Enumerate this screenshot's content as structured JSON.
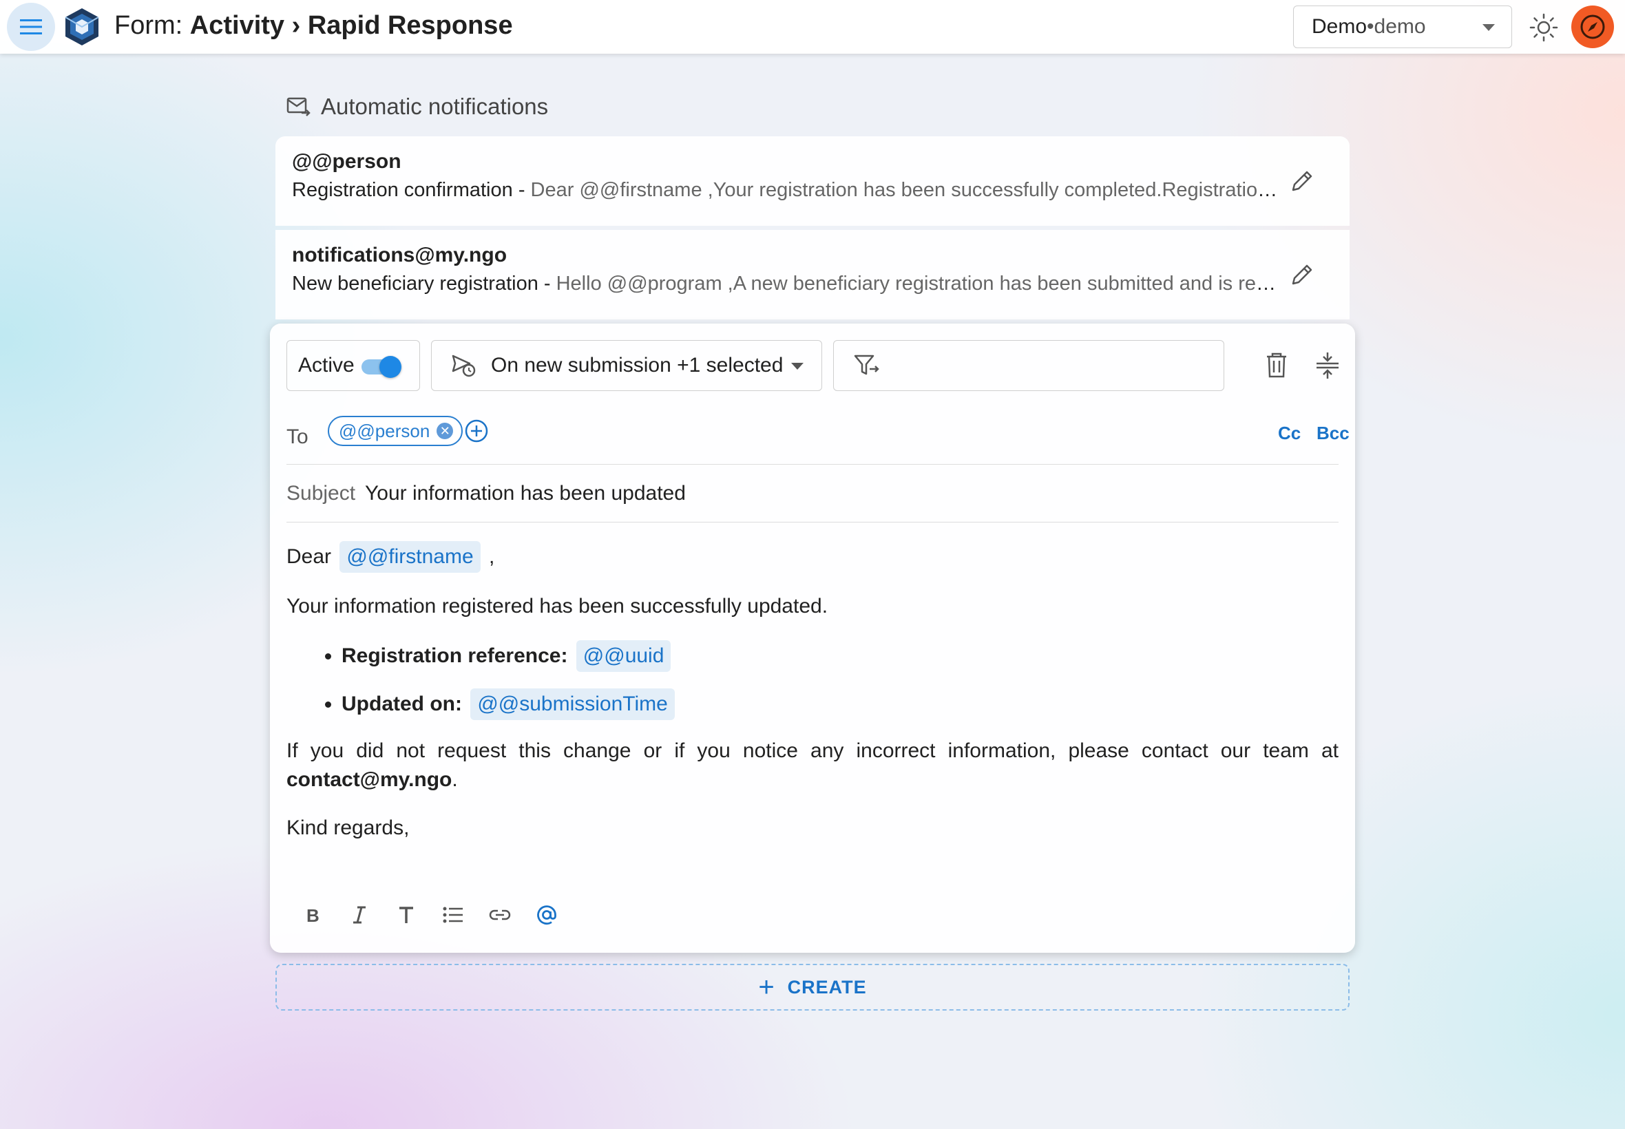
{
  "header": {
    "title_prefix": "Form: ",
    "title_form": "Activity",
    "title_sep": " › ",
    "title_name": "Rapid Response",
    "space_name": "Demo",
    "space_sep": " • ",
    "space_user": "demo"
  },
  "section": {
    "title": "Automatic notifications"
  },
  "notifications": [
    {
      "to": "@@person",
      "subject": "Registration confirmation - ",
      "preview": "Dear @@firstname ,Your registration has been successfully completed.Registration reference: @@uuid"
    },
    {
      "to": "notifications@my.ngo",
      "subject": "New beneficiary registration - ",
      "preview": "Hello @@program ,A new beneficiary registration has been submitted and is ready for review."
    }
  ],
  "editor": {
    "active_label": "Active",
    "active": true,
    "trigger_label": "On new submission +1 selected",
    "to_label": "To",
    "to_chip": "@@person",
    "cc_label": "Cc",
    "bcc_label": "Bcc",
    "subject_label": "Subject",
    "subject_value": "Your information has been updated",
    "body": {
      "greeting": "Dear",
      "greeting_tag": "@@firstname",
      "greeting_end": ",",
      "line1": "Your information registered has been successfully updated.",
      "item1_label": "Registration reference:",
      "item1_tag": "@@uuid",
      "item2_label": "Updated on:",
      "item2_tag": "@@submissionTime",
      "line2": "If you did not request this change or if you notice any incorrect information, please contact our team at ",
      "line2_email": "contact@my.ngo",
      "line2_end": ".",
      "closing": "Kind regards,"
    }
  },
  "create_label": "CREATE",
  "colors": {
    "accent": "#1a73c8",
    "toggle": "#1e88e5",
    "avatar": "#f15a24"
  }
}
